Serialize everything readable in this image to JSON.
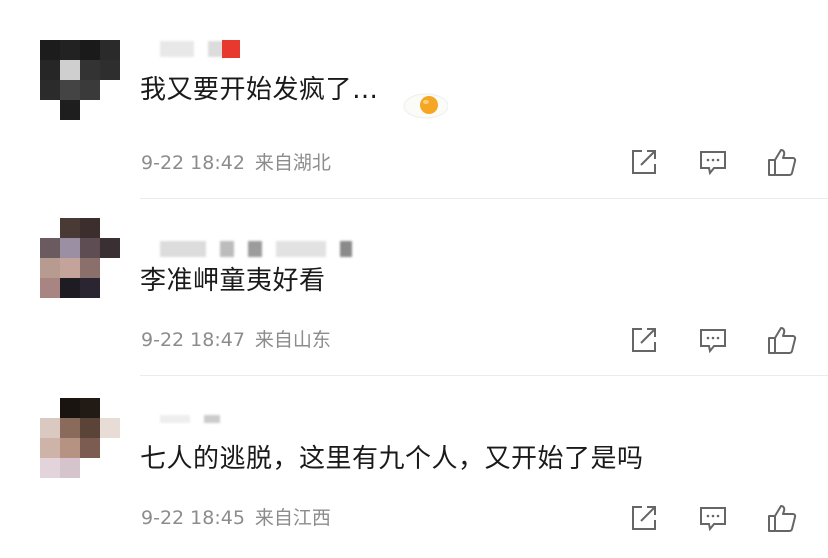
{
  "comments": [
    {
      "text": "我又要开始发疯了…",
      "date": "9-22 18:42",
      "location": "来自湖北"
    },
    {
      "text": "李准岬童夷好看",
      "date": "9-22 18:47",
      "location": "来自山东"
    },
    {
      "text": "七人的逃脱，这里有九个人，又开始了是吗",
      "date": "9-22 18:45",
      "location": "来自江西"
    }
  ],
  "icons": {
    "share": "share-icon",
    "comment": "comment-icon",
    "like": "thumbs-up-icon"
  },
  "colors": {
    "text": "#1a1a1a",
    "meta": "#8c8c8c",
    "icon": "#666666",
    "badge": "#e8392f"
  }
}
